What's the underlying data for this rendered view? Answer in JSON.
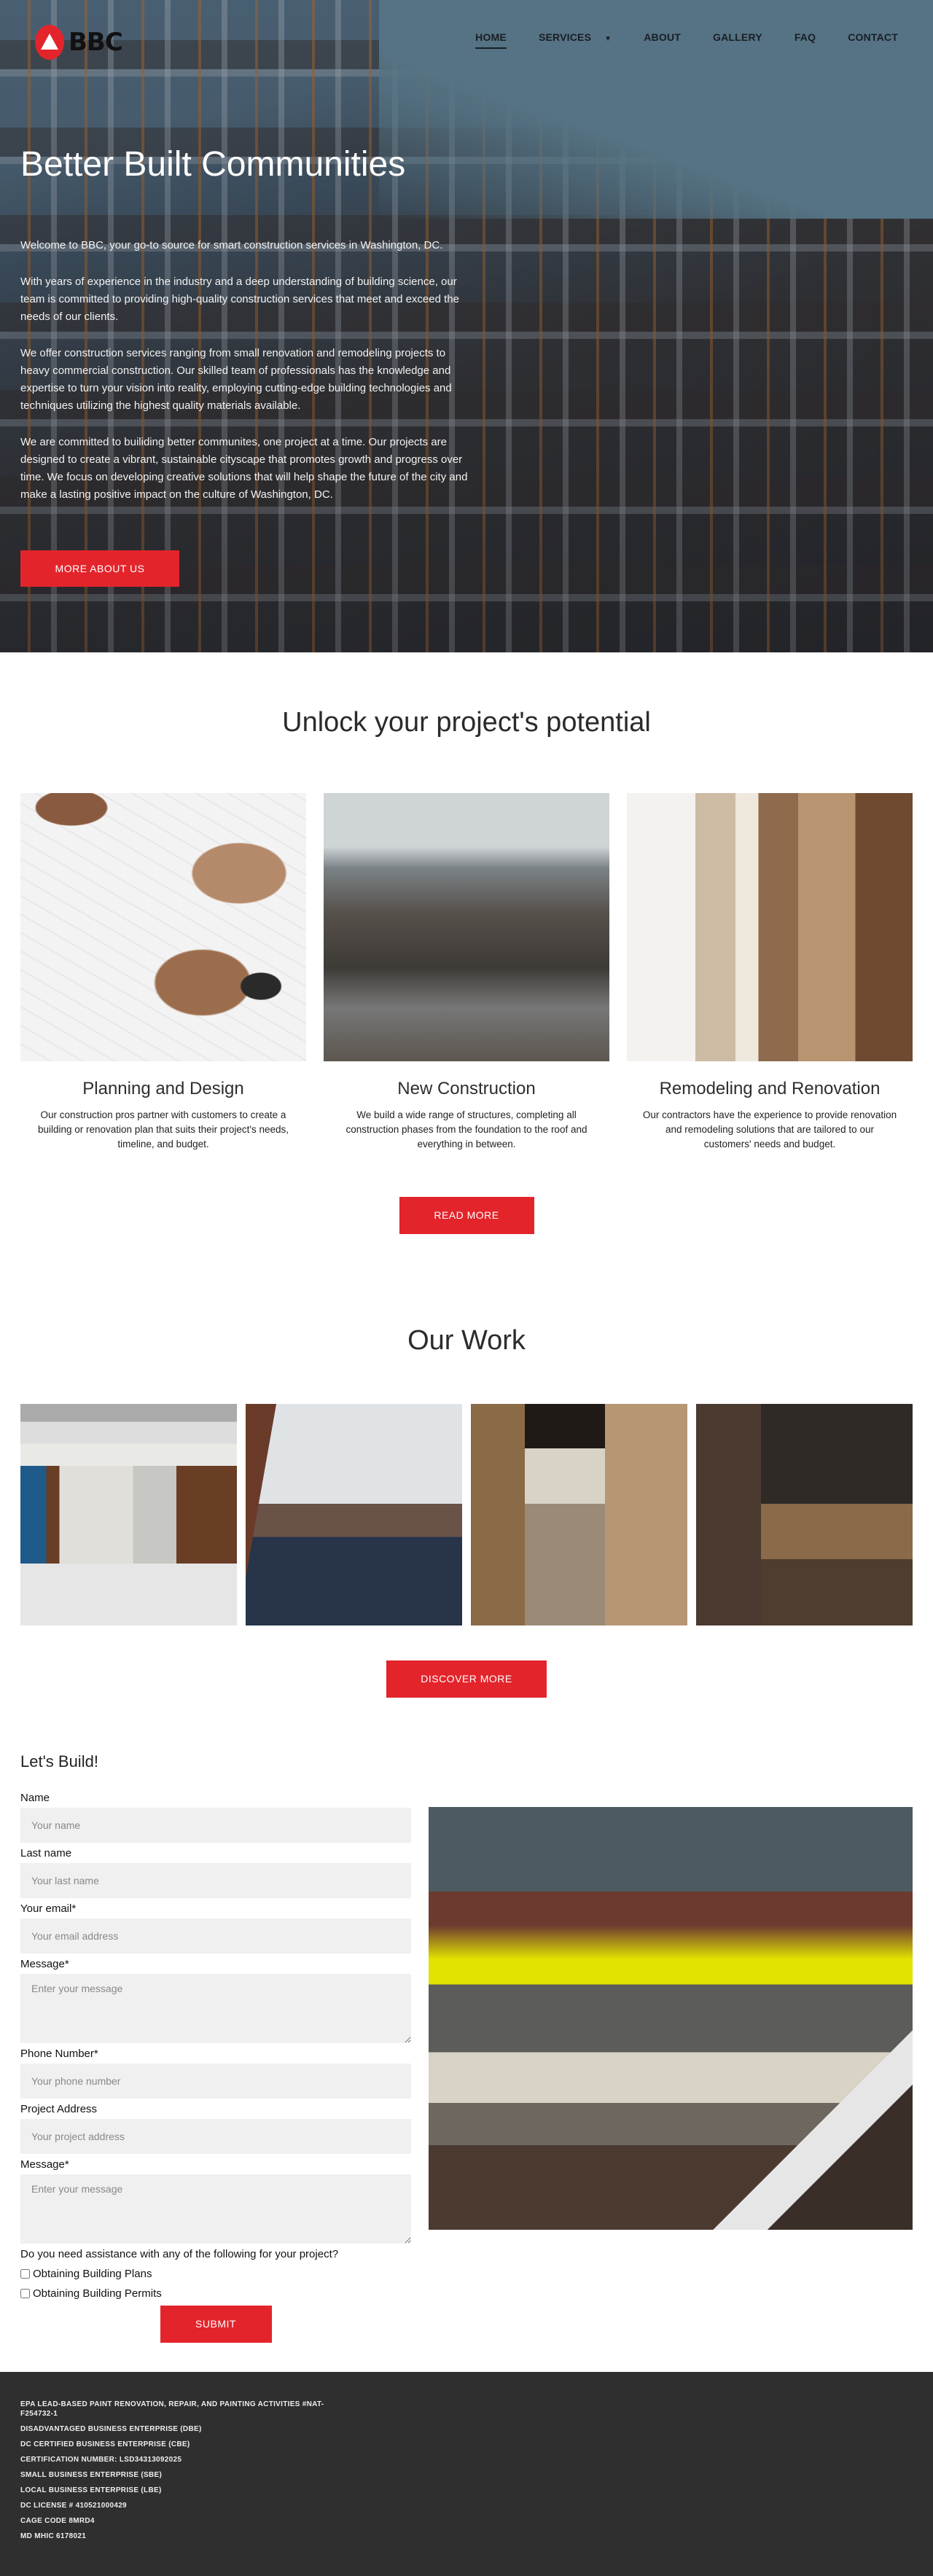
{
  "brand": {
    "name": "BBC",
    "accent_color": "#e3242b"
  },
  "nav": {
    "items": [
      {
        "label": "HOME",
        "active": true
      },
      {
        "label": "SERVICES",
        "has_dropdown": true
      },
      {
        "label": "ABOUT"
      },
      {
        "label": "GALLERY"
      },
      {
        "label": "FAQ"
      },
      {
        "label": "CONTACT"
      }
    ],
    "dropdown_icon": "▼"
  },
  "hero": {
    "title": "Better Built Communities",
    "paragraphs": [
      "Welcome to BBC, your go-to source for smart construction services in Washington, DC.",
      "With years of experience in the industry and a deep understanding of building science, our team is committed to providing high-quality construction services that meet and exceed the needs of our clients.",
      "We offer construction services ranging from small renovation and remodeling projects to heavy commercial construction. Our skilled team of professionals has the knowledge and expertise to turn your vision into reality, employing cutting-edge building technologies and techniques utilizing the highest quality materials available.",
      "We are committed to builiding better communites, one project at a time. Our projects are designed to create a vibrant, sustainable cityscape that promotes growth and progress over time. We focus on developing creative solutions that will help shape the future of the city and make a lasting positive impact on the culture of Washington, DC."
    ],
    "cta": "MORE ABOUT US"
  },
  "services": {
    "title": "Unlock your project's potential",
    "cards": [
      {
        "title": "Planning and Design",
        "text": "Our construction pros partner with customers to create a building or renovation plan that suits their project's needs, timeline, and budget."
      },
      {
        "title": "New Construction",
        "text": "We build a wide range of structures, completing all construction phases from the foundation to the roof and everything in between."
      },
      {
        "title": "Remodeling and Renovation",
        "text": "Our contractors have the experience to provide renovation and remodeling solutions that are tailored to our customers' needs and budget."
      }
    ],
    "cta": "READ MORE"
  },
  "work": {
    "title": "Our Work",
    "cta": "DISCOVER MORE"
  },
  "contact": {
    "title": "Let's Build!",
    "fields": {
      "name": {
        "label": "Name",
        "placeholder": "Your name"
      },
      "last_name": {
        "label": "Last name",
        "placeholder": "Your last name"
      },
      "email": {
        "label": "Your email*",
        "placeholder": "Your email address"
      },
      "message1": {
        "label": "Message*",
        "placeholder": "Enter your message"
      },
      "phone": {
        "label": "Phone Number*",
        "placeholder": "Your phone number"
      },
      "address": {
        "label": "Project Address",
        "placeholder": "Your project address"
      },
      "message2": {
        "label": "Message*",
        "placeholder": "Enter your message"
      }
    },
    "question": "Do you need assistance with any of the following for your project?",
    "options": [
      {
        "label": "Obtaining Building Plans",
        "checked": false
      },
      {
        "label": "Obtaining Building Permits",
        "checked": false
      }
    ],
    "submit": "SUBMIT"
  },
  "footer": {
    "lines": [
      "EPA LEAD-BASED PAINT RENOVATION, REPAIR, AND PAINTING ACTIVITIES #NAT-F254732-1",
      "DISADVANTAGED BUSINESS ENTERPRISE (DBE)",
      "DC CERTIFIED BUSINESS ENTERPRISE (CBE)",
      "CERTIFICATION NUMBER: LSD34313092025",
      "SMALL BUSINESS ENTERPRISE (SBE)",
      "LOCAL BUSINESS ENTERPRISE (LBE)",
      "DC LICENSE # 410521000429",
      "CAGE CODE 8MRD4",
      "MD MHIC 6178021"
    ]
  }
}
